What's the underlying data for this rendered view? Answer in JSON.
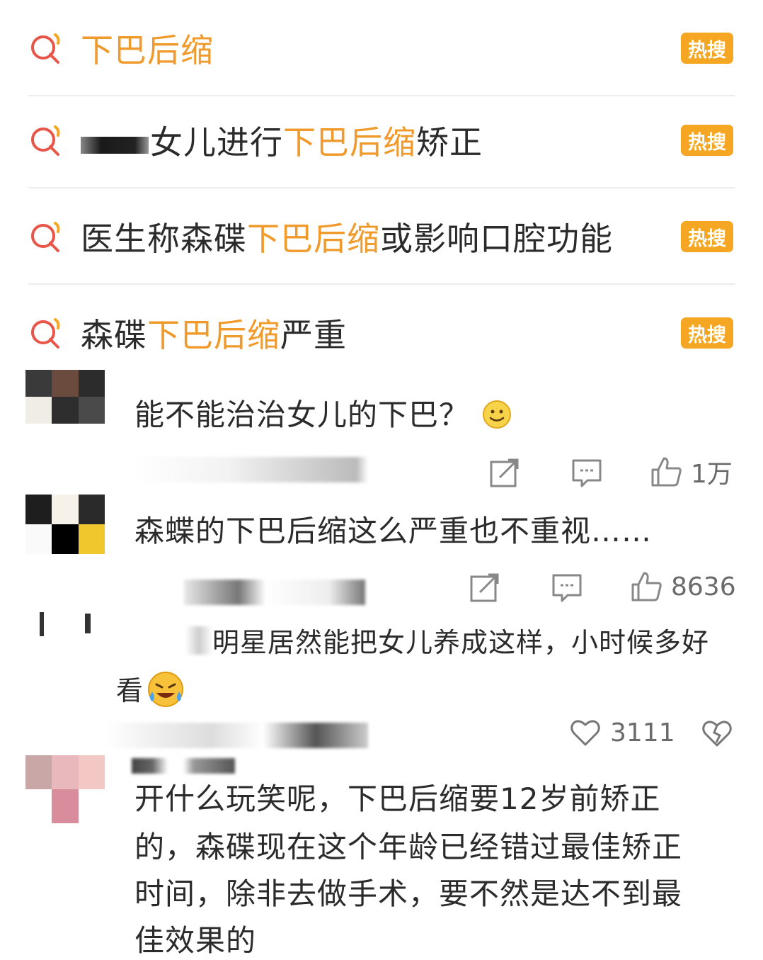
{
  "hot_searches": [
    {
      "pre": "",
      "highlight": "下巴后缩",
      "post": "",
      "badge": "热搜",
      "redacted": false
    },
    {
      "pre": "女儿进行",
      "highlight": "下巴后缩",
      "post": "矫正",
      "badge": "热搜",
      "redacted": true
    },
    {
      "pre": "医生称森碟",
      "highlight": "下巴后缩",
      "post": "或影响口腔功能",
      "badge": "热搜",
      "redacted": false
    },
    {
      "pre": "森碟",
      "highlight": "下巴后缩",
      "post": "严重",
      "badge": "热搜",
      "redacted": false
    }
  ],
  "comments": [
    {
      "text": "能不能治治女儿的下巴？",
      "like_count": "1万",
      "emoji": "smile"
    },
    {
      "text": "森蝶的下巴后缩这么严重也不重视……",
      "like_count": "8636"
    },
    {
      "text_line1": "明星居然能把女儿养成这样，小时候多好",
      "text_line2": "看",
      "like_count": "3111",
      "emoji": "laugh-cry"
    },
    {
      "lines": [
        "开什么玩笑呢，下巴后缩要12岁前矫正",
        "的，森碟现在这个年龄已经错过最佳矫正",
        "时间，除非去做手术，要不然是达不到最",
        "佳效果的"
      ]
    }
  ],
  "colors": {
    "highlight": "#f09a2c",
    "badge": "#f5a623",
    "icon_red": "#e8564a"
  },
  "icons": [
    "search-hot-icon",
    "share-icon",
    "comment-icon",
    "like-icon",
    "heart-icon",
    "broken-heart-icon"
  ]
}
